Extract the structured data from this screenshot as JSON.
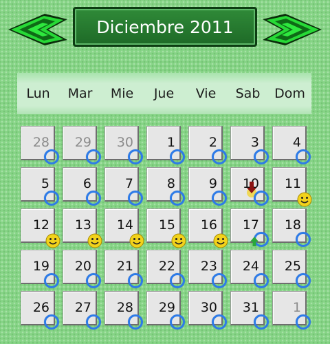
{
  "header": {
    "month_title": "Diciembre 2011"
  },
  "weekdays": [
    "Lun",
    "Mar",
    "Mie",
    "Jue",
    "Vie",
    "Sab",
    "Dom"
  ],
  "days": [
    {
      "label": "28",
      "other_month": true,
      "marker": "ring"
    },
    {
      "label": "29",
      "other_month": true,
      "marker": "ring"
    },
    {
      "label": "30",
      "other_month": true,
      "marker": "ring"
    },
    {
      "label": "1",
      "marker": "ring"
    },
    {
      "label": "2",
      "marker": "ring"
    },
    {
      "label": "3",
      "marker": "ring"
    },
    {
      "label": "4",
      "marker": "ring"
    },
    {
      "label": "5",
      "marker": "ring"
    },
    {
      "label": "6",
      "marker": "ring"
    },
    {
      "label": "7",
      "marker": "ring"
    },
    {
      "label": "8",
      "marker": "ring"
    },
    {
      "label": "9",
      "marker": "ring"
    },
    {
      "label": "10",
      "marker": "ring",
      "extra": "down-arrow-smiley"
    },
    {
      "label": "11",
      "marker": "smiley"
    },
    {
      "label": "12",
      "marker": "smiley"
    },
    {
      "label": "13",
      "marker": "smiley"
    },
    {
      "label": "14",
      "marker": "smiley"
    },
    {
      "label": "15",
      "marker": "smiley"
    },
    {
      "label": "16",
      "marker": "smiley"
    },
    {
      "label": "17",
      "marker": "ring",
      "extra": "up-arrow"
    },
    {
      "label": "18",
      "marker": "ring"
    },
    {
      "label": "19",
      "marker": "ring"
    },
    {
      "label": "20",
      "marker": "ring"
    },
    {
      "label": "21",
      "marker": "ring"
    },
    {
      "label": "22",
      "marker": "ring"
    },
    {
      "label": "23",
      "marker": "ring"
    },
    {
      "label": "24",
      "marker": "ring"
    },
    {
      "label": "25",
      "marker": "ring"
    },
    {
      "label": "26",
      "marker": "ring"
    },
    {
      "label": "27",
      "marker": "ring"
    },
    {
      "label": "28",
      "marker": "ring"
    },
    {
      "label": "29",
      "marker": "ring"
    },
    {
      "label": "30",
      "marker": "ring"
    },
    {
      "label": "31",
      "marker": "ring"
    },
    {
      "label": "1",
      "other_month": true,
      "marker": "ring"
    }
  ],
  "icons": {
    "prev": "left-arrow-icon",
    "next": "right-arrow-icon",
    "ring": "ring-icon",
    "smiley": "smiley-icon"
  },
  "colors": {
    "background": "#86d486",
    "title_bg": "#267a30",
    "ring": "#2d7be8",
    "arrow_green": "#22cc33"
  }
}
